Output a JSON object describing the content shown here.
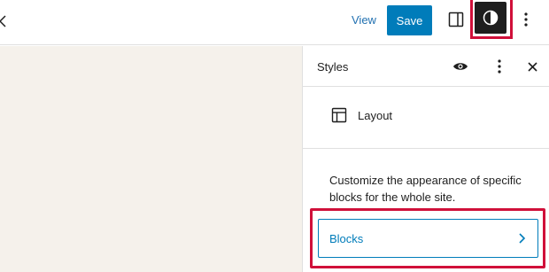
{
  "toolbar": {
    "view_label": "View",
    "save_label": "Save"
  },
  "sidebar": {
    "title": "Styles",
    "items": [
      {
        "label": "Layout",
        "icon": "layout-icon"
      }
    ],
    "description": "Customize the appearance of specific blocks for the whole site.",
    "blocks_label": "Blocks"
  },
  "colors": {
    "accent": "#007cba",
    "highlight": "#d0103a",
    "canvas": "#f5f1eb"
  }
}
